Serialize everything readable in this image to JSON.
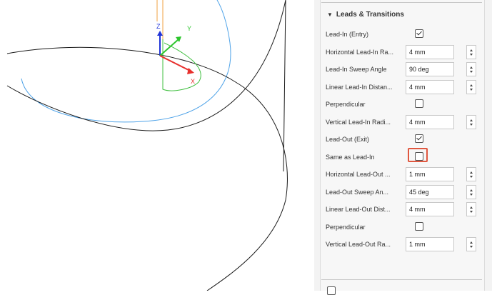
{
  "viewport": {
    "axis_labels": {
      "x": "X",
      "y": "Y",
      "z": "Z"
    },
    "colors": {
      "x_axis": "#e8302d",
      "y_axis": "#2dc52d",
      "z_axis": "#2033d8",
      "toolpath": "#3fbf3f",
      "circle": "#4fa3e8",
      "model": "#1a1a1a",
      "orange_path": "#f0a040"
    }
  },
  "panel": {
    "section": {
      "title": "Leads & Transitions",
      "expanded": true
    },
    "rows": [
      {
        "label": "Lead-In (Entry)",
        "type": "checkbox",
        "checked": true
      },
      {
        "label": "Horizontal Lead-In Ra...",
        "type": "spinner",
        "value": "4 mm"
      },
      {
        "label": "Lead-In Sweep Angle",
        "type": "spinner",
        "value": "90 deg"
      },
      {
        "label": "Linear Lead-In Distan...",
        "type": "spinner",
        "value": "4 mm"
      },
      {
        "label": "Perpendicular",
        "type": "checkbox",
        "checked": false
      },
      {
        "label": "Vertical Lead-In Radi...",
        "type": "spinner",
        "value": "4 mm"
      },
      {
        "label": "Lead-Out (Exit)",
        "type": "checkbox",
        "checked": true
      },
      {
        "label": "Same as Lead-In",
        "type": "checkbox",
        "checked": false,
        "highlighted": true
      },
      {
        "label": "Horizontal Lead-Out ...",
        "type": "spinner",
        "value": "1 mm"
      },
      {
        "label": "Lead-Out Sweep An...",
        "type": "spinner",
        "value": "45 deg"
      },
      {
        "label": "Linear Lead-Out Dist...",
        "type": "spinner",
        "value": "4 mm"
      },
      {
        "label": "Perpendicular",
        "type": "checkbox",
        "checked": false
      },
      {
        "label": "Vertical Lead-Out Ra...",
        "type": "spinner",
        "value": "1 mm"
      }
    ],
    "highlight_color": "#e0573f"
  }
}
